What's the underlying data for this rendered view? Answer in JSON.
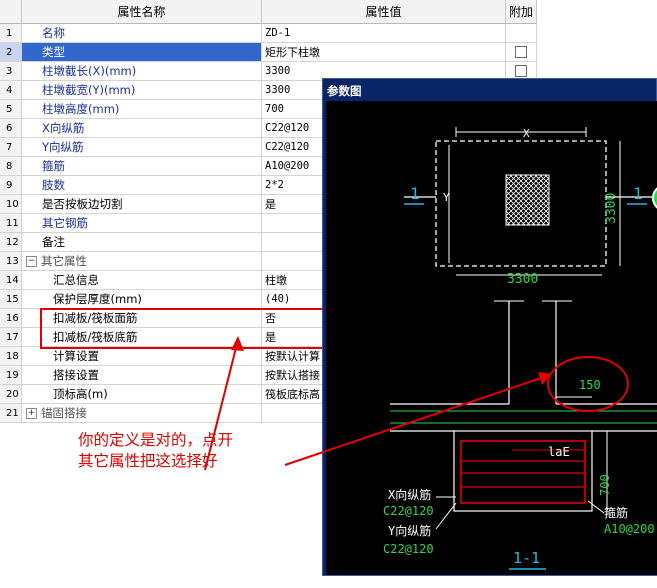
{
  "grid": {
    "col_name": "属性名称",
    "col_value": "属性值",
    "col_add": "附加",
    "rows": [
      {
        "num": "1",
        "name": "名称",
        "value": "ZD-1"
      },
      {
        "num": "2",
        "name": "类型",
        "value": "矩形下柱墩"
      },
      {
        "num": "3",
        "name": "柱墩截长(X)(mm)",
        "value": "3300"
      },
      {
        "num": "4",
        "name": "柱墩截宽(Y)(mm)",
        "value": "3300"
      },
      {
        "num": "5",
        "name": "柱墩高度(mm)",
        "value": "700"
      },
      {
        "num": "6",
        "name": "X向纵筋",
        "value": "C22@120"
      },
      {
        "num": "7",
        "name": "Y向纵筋",
        "value": "C22@120"
      },
      {
        "num": "8",
        "name": "箍筋",
        "value": "A10@200"
      },
      {
        "num": "9",
        "name": "肢数",
        "value": "2*2"
      },
      {
        "num": "10",
        "name": "是否按板边切割",
        "value": "是"
      },
      {
        "num": "11",
        "name": "其它钢筋",
        "value": ""
      },
      {
        "num": "12",
        "name": "备注",
        "value": ""
      },
      {
        "num": "13",
        "name": "其它属性",
        "value": "",
        "toggle": "−"
      },
      {
        "num": "14",
        "name": "汇总信息",
        "value": "柱墩"
      },
      {
        "num": "15",
        "name": "保护层厚度(mm)",
        "value": "(40)"
      },
      {
        "num": "16",
        "name": "扣减板/筏板面筋",
        "value": "否"
      },
      {
        "num": "17",
        "name": "扣减板/筏板底筋",
        "value": "是"
      },
      {
        "num": "18",
        "name": "计算设置",
        "value": "按默认计算"
      },
      {
        "num": "19",
        "name": "搭接设置",
        "value": "按默认搭接"
      },
      {
        "num": "20",
        "name": "顶标高(m)",
        "value": "筏板底标高"
      },
      {
        "num": "21",
        "name": "锚固搭接",
        "value": "",
        "toggle": "+"
      }
    ]
  },
  "annotation": {
    "line1": "你的定义是对的，点开",
    "line2": "其它属性把这选择好",
    "color": "#e00000"
  },
  "diagram_window": {
    "title": "参数图",
    "labels": {
      "x": "X",
      "y": "Y",
      "sec_left": "1",
      "sec_right": "1",
      "dim_width": "3300",
      "dim_height": "3300",
      "dim_150": "150",
      "lae": "laE",
      "dim_700": "700",
      "x_bar_title": "X向纵筋",
      "x_bar_value": "C22@120",
      "y_bar_title": "Y向纵筋",
      "y_bar_value": "C22@120",
      "stirrup_title": "箍筋",
      "stirrup_value": "A10@200",
      "section_title": "1-1"
    }
  },
  "colors": {
    "selection": "#3366cc",
    "blue_text": "#1a2fa0",
    "drawing_bg": "#000000",
    "cad_green": "#2bd84a",
    "cad_cyan": "#22b8e0"
  }
}
